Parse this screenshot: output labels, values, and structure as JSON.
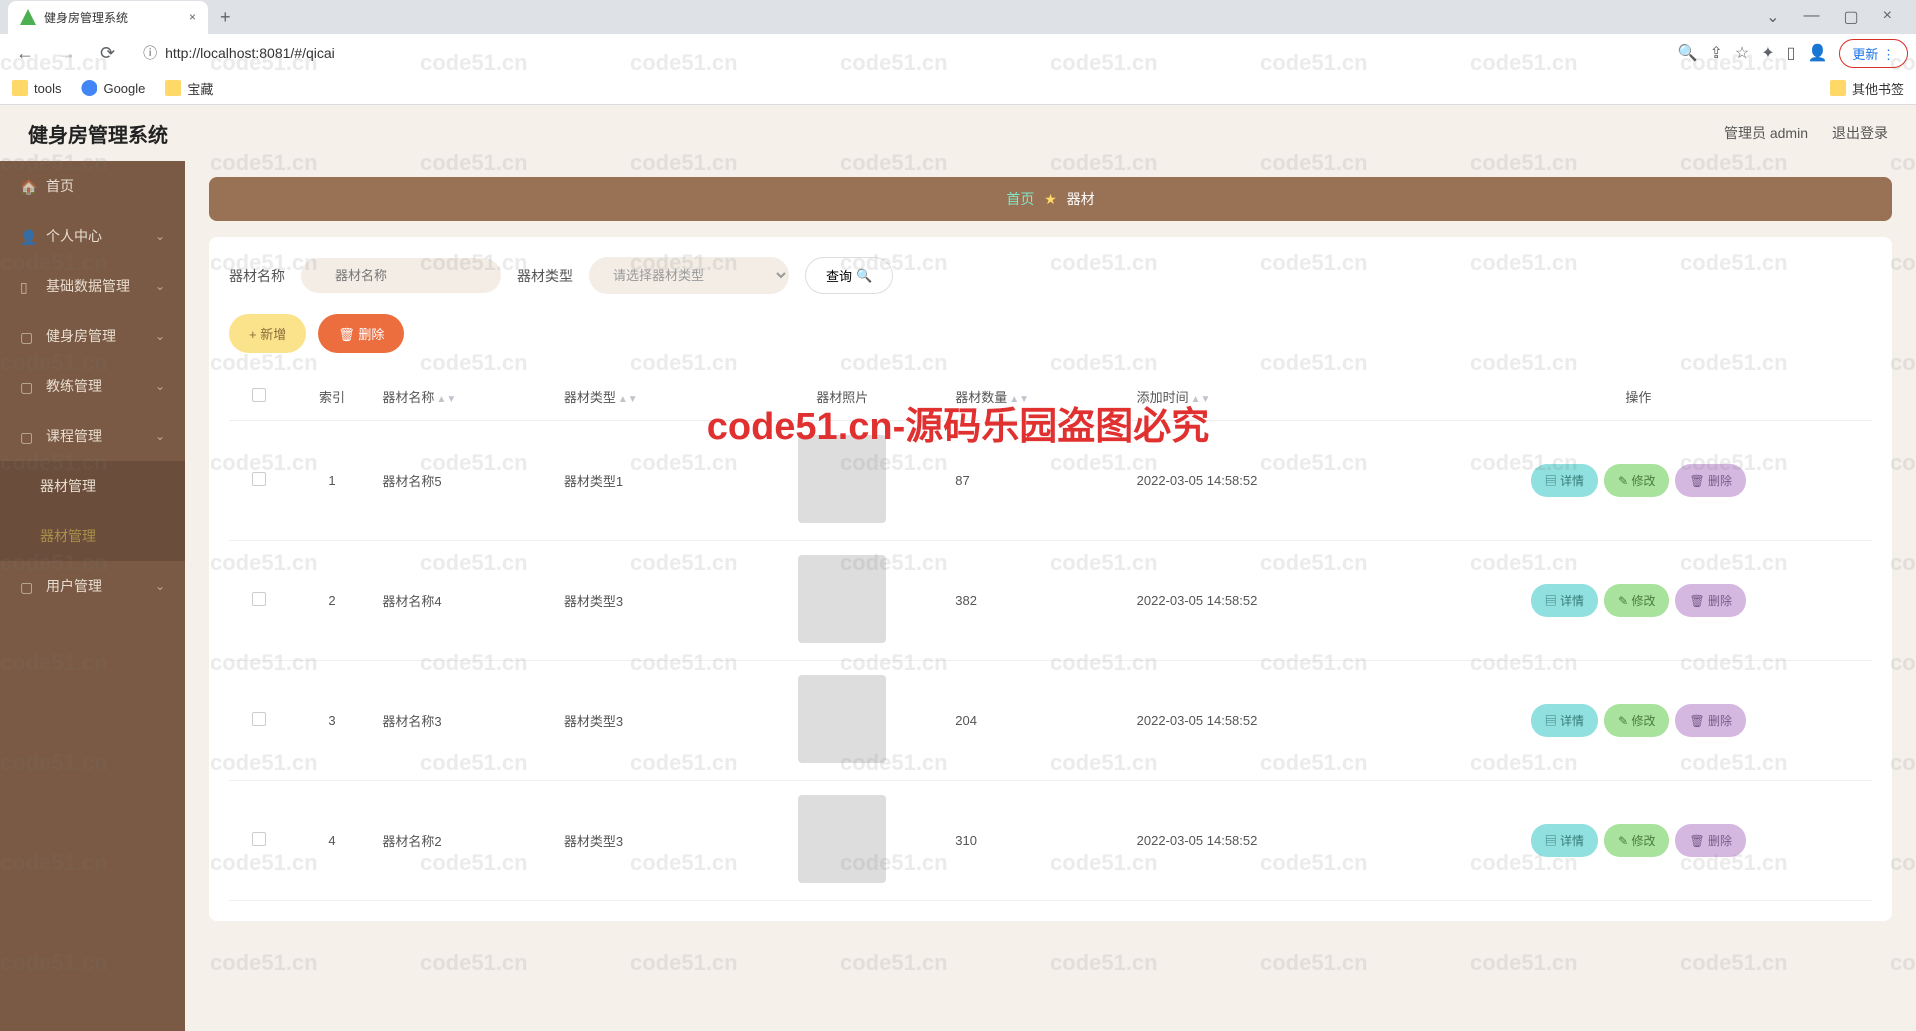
{
  "browser": {
    "tab_title": "健身房管理系统",
    "url": "http://localhost:8081/#/qicai",
    "url_prefix": "ⓘ ",
    "bookmarks": [
      "tools",
      "Google",
      "宝藏"
    ],
    "other_bookmarks": "其他书签",
    "update": "更新"
  },
  "header": {
    "title": "健身房管理系统",
    "user": "管理员 admin",
    "logout": "退出登录"
  },
  "sidebar": {
    "items": [
      {
        "label": "首页",
        "expandable": false
      },
      {
        "label": "个人中心",
        "expandable": true
      },
      {
        "label": "基础数据管理",
        "expandable": true
      },
      {
        "label": "健身房管理",
        "expandable": true
      },
      {
        "label": "教练管理",
        "expandable": true
      },
      {
        "label": "课程管理",
        "expandable": true
      },
      {
        "label": "器材管理",
        "expandable": false,
        "sub": true
      },
      {
        "label": "器材管理",
        "expandable": false,
        "sub": true,
        "active": true
      },
      {
        "label": "用户管理",
        "expandable": true
      }
    ]
  },
  "breadcrumb": {
    "home": "首页",
    "current": "器材"
  },
  "filters": {
    "name_label": "器材名称",
    "name_placeholder": "器材名称",
    "type_label": "器材类型",
    "type_placeholder": "请选择器材类型",
    "query": "查询"
  },
  "actions": {
    "add": "+ 新增",
    "delete": "删除"
  },
  "table": {
    "headers": [
      "",
      "索引",
      "器材名称",
      "器材类型",
      "器材照片",
      "器材数量",
      "添加时间",
      "操作"
    ],
    "row_actions": {
      "detail": "详情",
      "edit": "修改",
      "delete": "删除"
    },
    "rows": [
      {
        "idx": "1",
        "name": "器材名称5",
        "type": "器材类型1",
        "qty": "87",
        "time": "2022-03-05 14:58:52"
      },
      {
        "idx": "2",
        "name": "器材名称4",
        "type": "器材类型3",
        "qty": "382",
        "time": "2022-03-05 14:58:52"
      },
      {
        "idx": "3",
        "name": "器材名称3",
        "type": "器材类型3",
        "qty": "204",
        "time": "2022-03-05 14:58:52"
      },
      {
        "idx": "4",
        "name": "器材名称2",
        "type": "器材类型3",
        "qty": "310",
        "time": "2022-03-05 14:58:52"
      }
    ]
  },
  "watermark": "code51.cn",
  "big_watermark": "code51.cn-源码乐园盗图必究"
}
